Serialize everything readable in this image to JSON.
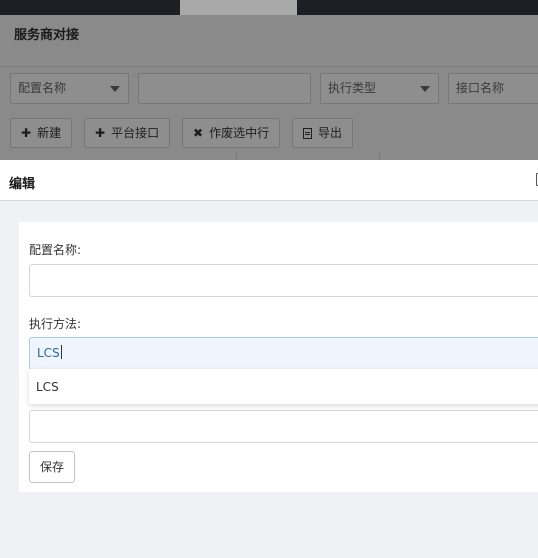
{
  "background": {
    "title": "服务商对接",
    "filters": [
      {
        "value": "配置名称",
        "type": "select"
      },
      {
        "value": "",
        "type": "input"
      },
      {
        "value": "执行类型",
        "type": "select"
      },
      {
        "value": "接口名称",
        "type": "input"
      }
    ],
    "toolbar": {
      "new_label": "新建",
      "platform_label": "平台接口",
      "void_label": "作废选中行",
      "export_label": "导出"
    }
  },
  "modal": {
    "title": "编辑",
    "form": {
      "config_name_label": "配置名称:",
      "config_name_value": "",
      "exec_method_label": "执行方法:",
      "exec_method_value": "LCS",
      "dropdown_option": "LCS",
      "third_value": "",
      "save_label": "保存"
    }
  },
  "colors": {
    "overlay": "#808080",
    "topbar": "#1e1f24",
    "modal_bg": "#f0f1f4",
    "active_input_bg": "#eef5fc",
    "active_input_text": "#2b68a6"
  }
}
